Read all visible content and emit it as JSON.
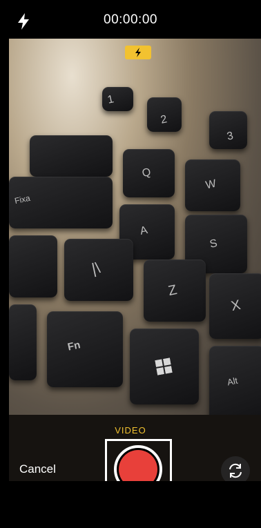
{
  "top_bar": {
    "flash_icon": "flash-icon",
    "timer": "00:00:00"
  },
  "viewfinder": {
    "flash_indicator_icon": "flash-icon",
    "keys": [
      "1",
      "2",
      "3",
      "Q",
      "W",
      "Fixa",
      "A",
      "S",
      "|\\",
      "Z",
      "X",
      "Fn",
      "Alt"
    ]
  },
  "controls": {
    "mode_label": "VIDEO",
    "cancel_label": "Cancel",
    "shutter_icon": "record-icon",
    "switch_camera_icon": "switch-camera-icon"
  },
  "colors": {
    "accent_yellow": "#f2c230",
    "record_red": "#e8403a"
  }
}
